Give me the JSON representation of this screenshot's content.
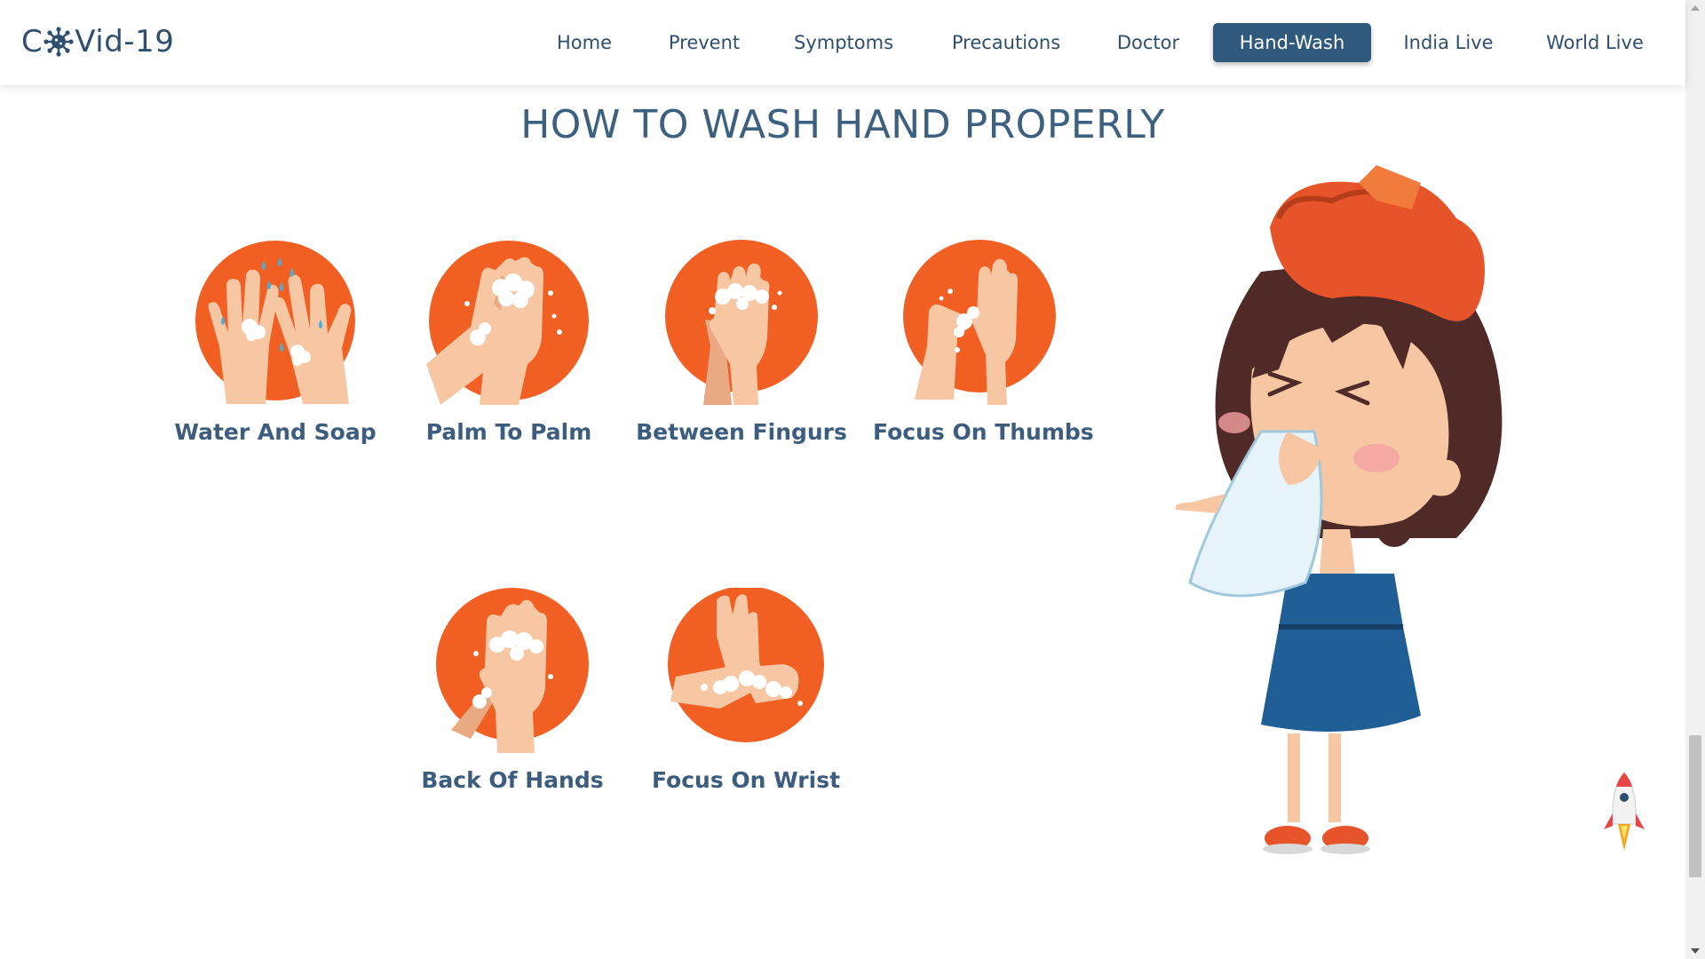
{
  "brand": {
    "prefix": "C",
    "suffix": "Vid-19"
  },
  "nav": {
    "items": [
      "Home",
      "Prevent",
      "Symptoms",
      "Precautions",
      "Doctor",
      "Hand-Wash",
      "India Live",
      "World Live"
    ],
    "active": "Hand-Wash"
  },
  "page_title": "HOW TO WASH HAND PROPERLY",
  "steps": [
    {
      "label": "Water And Soap",
      "icon": "hands-water-soap-icon"
    },
    {
      "label": "Palm To Palm",
      "icon": "palm-to-palm-icon"
    },
    {
      "label": "Between Fingurs",
      "icon": "between-fingers-icon"
    },
    {
      "label": "Focus On Thumbs",
      "icon": "thumbs-icon"
    },
    {
      "label": "Back Of Hands",
      "icon": "back-of-hands-icon"
    },
    {
      "label": "Focus On Wrist",
      "icon": "wrist-icon"
    }
  ],
  "colors": {
    "accent_orange": "#f15f22",
    "navy": "#2f4f6f",
    "active_nav": "#2f5a7e",
    "skin": "#f7c6a3",
    "foam": "#ffffff",
    "water": "#3fb2e0"
  },
  "illustration": "sneezing-girl-with-ice-bag",
  "scroll_to_top": "rocket-icon"
}
